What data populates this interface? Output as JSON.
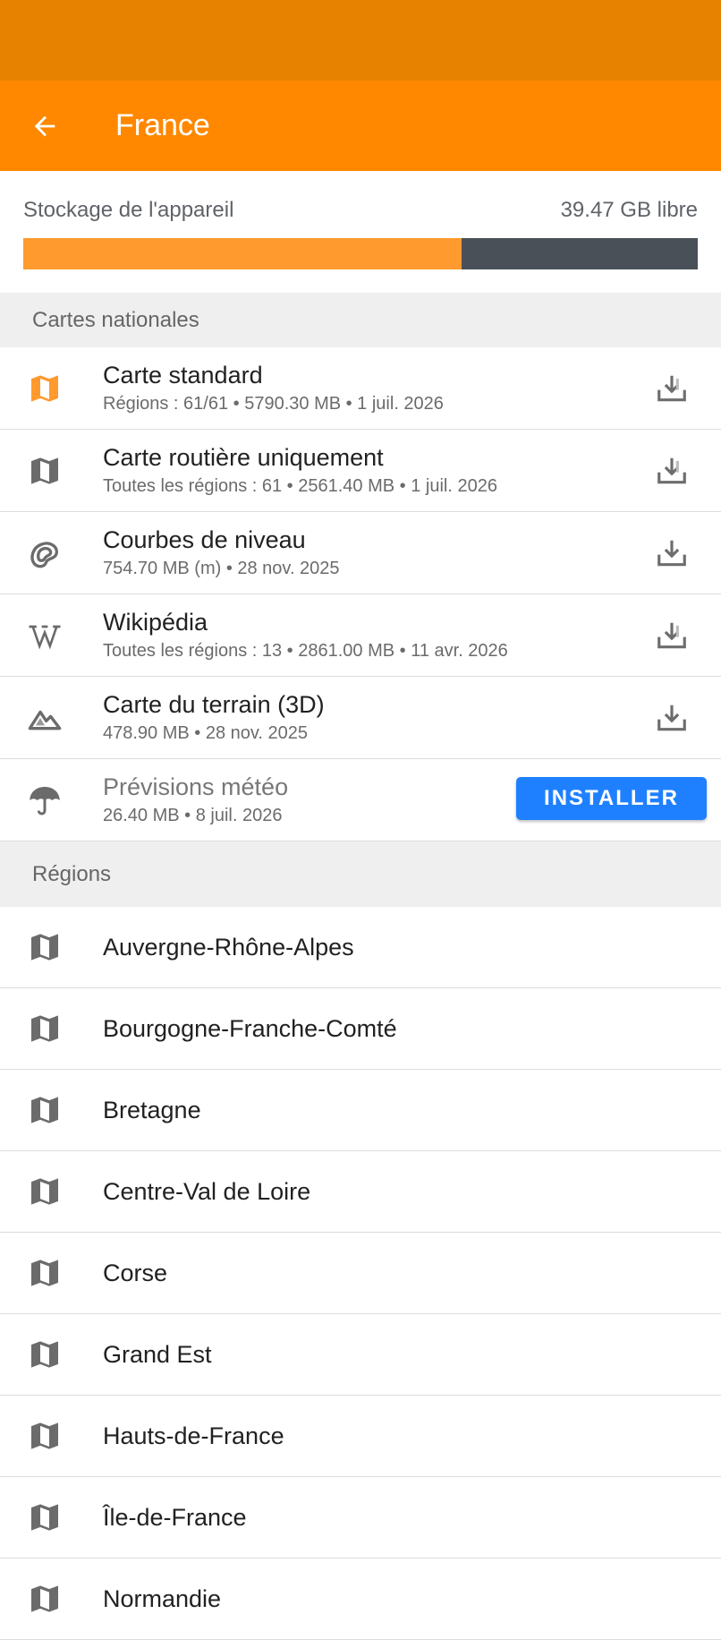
{
  "header": {
    "title": "France"
  },
  "storage": {
    "label": "Stockage de l'appareil",
    "free": "39.47 GB libre",
    "used_fraction": 0.65
  },
  "sections": {
    "national": "Cartes nationales",
    "regions": "Régions"
  },
  "national_maps": [
    {
      "title": "Carte standard",
      "sub": "Régions : 61/61 • 5790.30 MB • 1 juil. 2026",
      "icon": "map-icon-orange"
    },
    {
      "title": "Carte routière uniquement",
      "sub": "Toutes les régions : 61 • 2561.40 MB • 1 juil. 2026",
      "icon": "map-icon"
    },
    {
      "title": "Courbes de niveau",
      "sub": "754.70 MB (m) • 28 nov. 2025",
      "icon": "contour-lines-icon"
    },
    {
      "title": "Wikipédia",
      "sub": "Toutes les régions : 13 • 2861.00 MB • 11 avr. 2026",
      "icon": "wikipedia-icon"
    },
    {
      "title": "Carte du terrain (3D)",
      "sub": "478.90 MB • 28 nov. 2025",
      "icon": "terrain-icon"
    },
    {
      "title": "Prévisions météo",
      "sub": "26.40 MB • 8 juil. 2026",
      "icon": "umbrella-icon",
      "button": "INSTALLER"
    }
  ],
  "regions": [
    "Auvergne-Rhône-Alpes",
    "Bourgogne-Franche-Comté",
    "Bretagne",
    "Centre-Val de Loire",
    "Corse",
    "Grand Est",
    "Hauts-de-France",
    "Île-de-France",
    "Normandie"
  ],
  "colors": {
    "status_bar": "#e78100",
    "app_bar": "#ff8800",
    "storage_used": "#ff9a2e",
    "storage_free": "#495058",
    "install_button": "#1f80ff"
  }
}
